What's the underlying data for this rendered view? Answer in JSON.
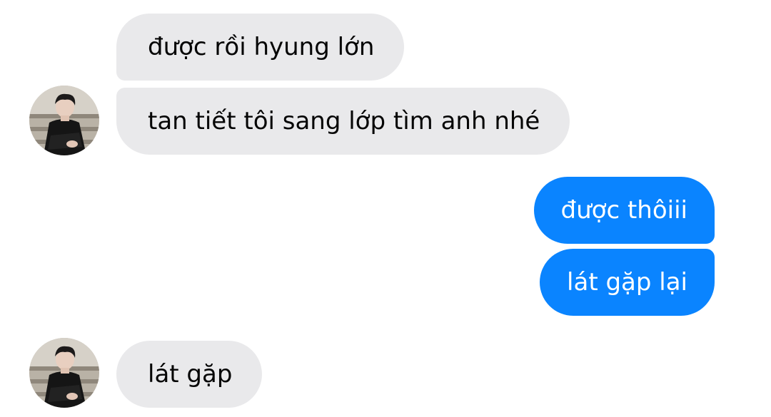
{
  "conversation": {
    "messages": [
      {
        "sender": "other",
        "text": "được rồi hyung lớn"
      },
      {
        "sender": "other",
        "text": "tan tiết tôi sang lớp tìm anh nhé"
      },
      {
        "sender": "me",
        "text": "được thôiii"
      },
      {
        "sender": "me",
        "text": "lát gặp lại"
      },
      {
        "sender": "other",
        "text": "lát gặp"
      }
    ]
  },
  "colors": {
    "incoming_bubble": "#e9e9eb",
    "outgoing_bubble": "#0a84ff",
    "incoming_text": "#050505",
    "outgoing_text": "#ffffff",
    "background": "#ffffff"
  },
  "avatar": {
    "icon": "contact-photo-avatar"
  }
}
